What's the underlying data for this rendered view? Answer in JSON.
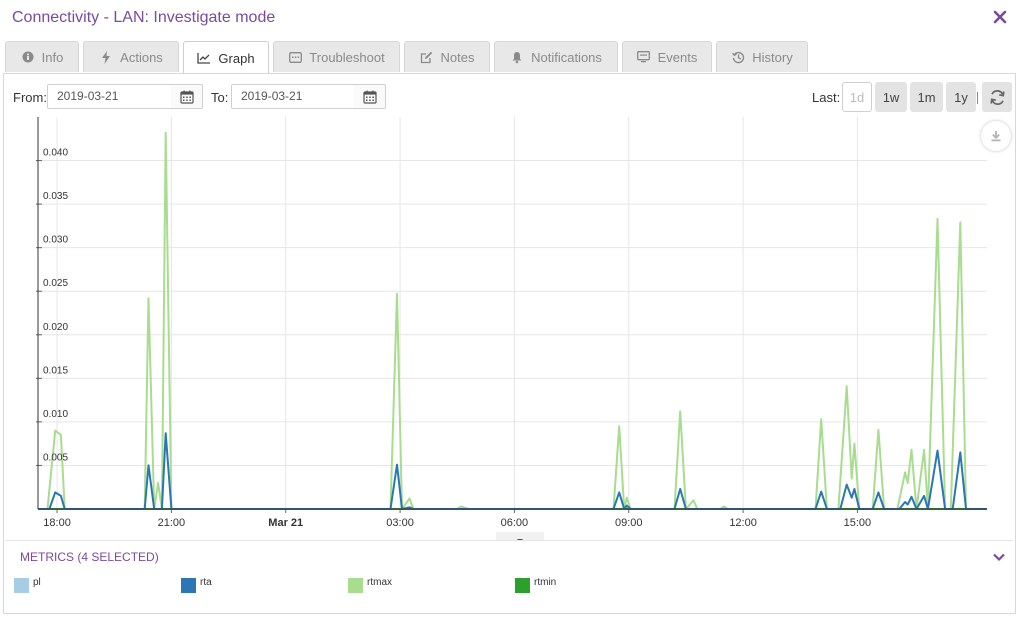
{
  "window": {
    "title": "Connectivity - LAN: Investigate mode"
  },
  "tabs": [
    {
      "label": "Info",
      "icon": "info-icon"
    },
    {
      "label": "Actions",
      "icon": "bolt-icon"
    },
    {
      "label": "Graph",
      "icon": "graph-icon",
      "active": true
    },
    {
      "label": "Troubleshoot",
      "icon": "console-icon"
    },
    {
      "label": "Notes",
      "icon": "edit-icon"
    },
    {
      "label": "Notifications",
      "icon": "bell-icon"
    },
    {
      "label": "Events",
      "icon": "monitor-icon"
    },
    {
      "label": "History",
      "icon": "history-icon"
    }
  ],
  "toolbar": {
    "from_label": "From:",
    "from_value": "2019-03-21",
    "to_label": "To:",
    "to_value": "2019-03-21",
    "last_label": "Last:",
    "ranges": [
      "1d",
      "1w",
      "1m",
      "1y"
    ],
    "active_range": "1d"
  },
  "chart_data": {
    "type": "line",
    "x_tick_labels": [
      "18:00",
      "21:00",
      "Mar 21",
      "03:00",
      "06:00",
      "09:00",
      "12:00",
      "15:00"
    ],
    "x_range_hours": [
      17.5,
      42.4
    ],
    "ylim": [
      0,
      0.045
    ],
    "y_ticks": [
      "0.005",
      "0.010",
      "0.015",
      "0.020",
      "0.025",
      "0.030",
      "0.035",
      "0.040"
    ],
    "grid": true,
    "series": [
      {
        "name": "rtmax",
        "color": "#a9dc8f",
        "points": [
          [
            17.5,
            0
          ],
          [
            17.75,
            0
          ],
          [
            17.95,
            0.009
          ],
          [
            18.1,
            0.0085
          ],
          [
            18.2,
            0
          ],
          [
            20.3,
            0
          ],
          [
            20.4,
            0.0242
          ],
          [
            20.55,
            0
          ],
          [
            20.65,
            0.003
          ],
          [
            20.75,
            0
          ],
          [
            20.85,
            0.0432
          ],
          [
            21.0,
            0
          ],
          [
            25.3,
            0
          ],
          [
            26.75,
            0
          ],
          [
            26.92,
            0.0247
          ],
          [
            27.05,
            0
          ],
          [
            27.25,
            0.0012
          ],
          [
            27.35,
            0
          ],
          [
            28.5,
            0
          ],
          [
            28.6,
            0.0003
          ],
          [
            28.8,
            0
          ],
          [
            32.6,
            0
          ],
          [
            32.75,
            0.0095
          ],
          [
            32.88,
            0
          ],
          [
            32.95,
            0.0013
          ],
          [
            33.05,
            0
          ],
          [
            34.2,
            0
          ],
          [
            34.35,
            0.0112
          ],
          [
            34.5,
            0
          ],
          [
            34.7,
            0.001
          ],
          [
            34.8,
            0
          ],
          [
            35.4,
            0
          ],
          [
            35.5,
            0.0003
          ],
          [
            35.6,
            0
          ],
          [
            37.9,
            0
          ],
          [
            38.05,
            0.0103
          ],
          [
            38.2,
            0
          ],
          [
            38.5,
            0
          ],
          [
            38.72,
            0.0141
          ],
          [
            38.85,
            0.0035
          ],
          [
            38.92,
            0.0075
          ],
          [
            39.05,
            0
          ],
          [
            39.4,
            0
          ],
          [
            39.55,
            0.0091
          ],
          [
            39.7,
            0
          ],
          [
            40.05,
            0
          ],
          [
            40.25,
            0.0042
          ],
          [
            40.32,
            0.003
          ],
          [
            40.42,
            0.0068
          ],
          [
            40.55,
            0
          ],
          [
            40.75,
            0.0068
          ],
          [
            40.85,
            0
          ],
          [
            41.1,
            0.0333
          ],
          [
            41.3,
            0
          ],
          [
            41.45,
            0
          ],
          [
            41.7,
            0.0329
          ],
          [
            41.85,
            0
          ],
          [
            42.4,
            0
          ]
        ]
      },
      {
        "name": "rta",
        "color": "#2a77b4",
        "points": [
          [
            17.5,
            0
          ],
          [
            17.8,
            0
          ],
          [
            17.95,
            0.0019
          ],
          [
            18.1,
            0.0015
          ],
          [
            18.2,
            0
          ],
          [
            20.3,
            0
          ],
          [
            20.4,
            0.005
          ],
          [
            20.55,
            0
          ],
          [
            20.75,
            0
          ],
          [
            20.85,
            0.0087
          ],
          [
            21.0,
            0
          ],
          [
            26.75,
            0
          ],
          [
            26.92,
            0.0051
          ],
          [
            27.05,
            0
          ],
          [
            27.25,
            0.0002
          ],
          [
            27.35,
            0
          ],
          [
            32.6,
            0
          ],
          [
            32.75,
            0.0019
          ],
          [
            32.88,
            0
          ],
          [
            32.95,
            0.0004
          ],
          [
            33.05,
            0
          ],
          [
            34.2,
            0
          ],
          [
            34.35,
            0.0023
          ],
          [
            34.5,
            0
          ],
          [
            37.9,
            0
          ],
          [
            38.05,
            0.002
          ],
          [
            38.2,
            0
          ],
          [
            38.55,
            0
          ],
          [
            38.72,
            0.0028
          ],
          [
            38.85,
            0.0013
          ],
          [
            38.92,
            0.0023
          ],
          [
            39.05,
            0
          ],
          [
            39.4,
            0
          ],
          [
            39.55,
            0.0019
          ],
          [
            39.7,
            0
          ],
          [
            40.1,
            0
          ],
          [
            40.25,
            0.0008
          ],
          [
            40.32,
            0.0005
          ],
          [
            40.42,
            0.0014
          ],
          [
            40.55,
            0
          ],
          [
            40.75,
            0.0015
          ],
          [
            40.85,
            0
          ],
          [
            41.1,
            0.0067
          ],
          [
            41.3,
            0
          ],
          [
            41.5,
            0
          ],
          [
            41.7,
            0.0065
          ],
          [
            41.85,
            0
          ],
          [
            42.4,
            0
          ]
        ]
      },
      {
        "name": "rtmin",
        "color": "#2ca02c",
        "points": [
          [
            17.5,
            0
          ],
          [
            42.4,
            0
          ]
        ]
      },
      {
        "name": "pl",
        "color": "#a6cde3",
        "points": [
          [
            17.5,
            0
          ],
          [
            42.4,
            0
          ]
        ]
      }
    ]
  },
  "metrics": {
    "title": "METRICS (4 SELECTED)",
    "items": [
      {
        "label": "pl",
        "color": "#a6cde3"
      },
      {
        "label": "rta",
        "color": "#2a77b4"
      },
      {
        "label": "rtmax",
        "color": "#a9dc8f"
      },
      {
        "label": "rtmin",
        "color": "#2ca02c"
      }
    ]
  }
}
